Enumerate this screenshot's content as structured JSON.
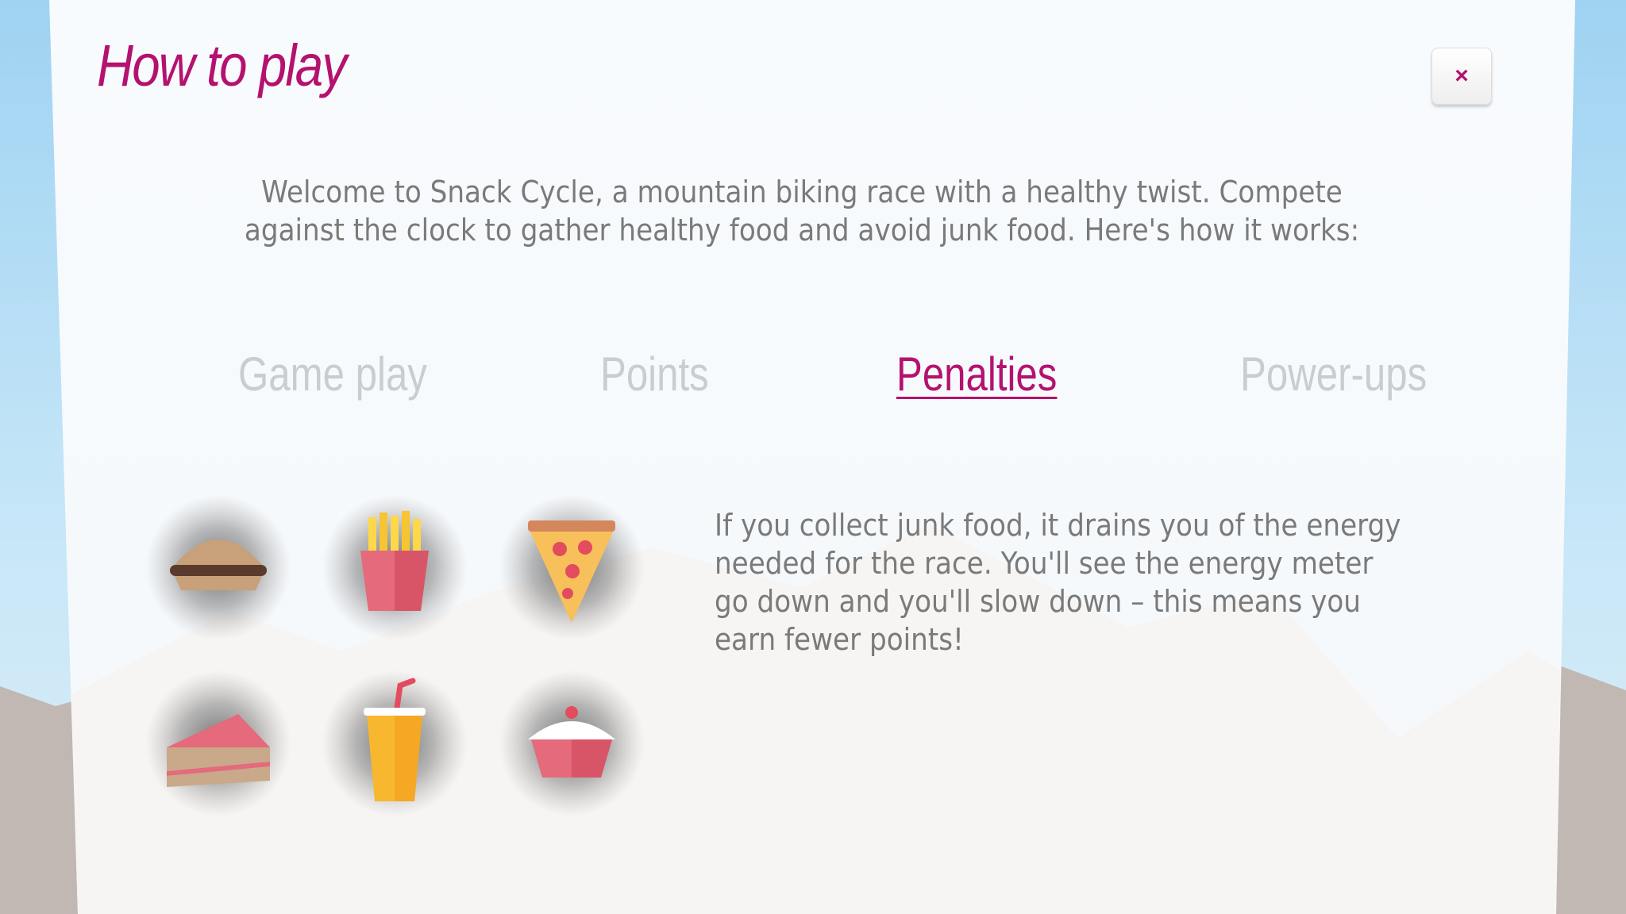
{
  "dialog": {
    "title": "How to play",
    "close_label": "×",
    "intro": "Welcome to Snack Cycle, a mountain biking race with a healthy twist. Compete against the clock to gather healthy food and avoid junk food. Here's how it works:"
  },
  "tabs": [
    {
      "label": "Game play",
      "active": false
    },
    {
      "label": "Points",
      "active": false
    },
    {
      "label": "Penalties",
      "active": true
    },
    {
      "label": "Power-ups",
      "active": false
    }
  ],
  "penalties": {
    "description": "If you collect junk food, it drains you of the energy needed for the race. You'll see the energy meter go down and you'll slow down – this means you earn fewer points!",
    "items": [
      "burger-icon",
      "fries-icon",
      "pizza-slice-icon",
      "cake-slice-icon",
      "soda-cup-icon",
      "cupcake-icon"
    ]
  },
  "colors": {
    "accent": "#b5116f",
    "tab_inactive": "#c9ccd0",
    "text": "#7a7a7a",
    "sky": "#9fd3f2",
    "mountain": "#c1b7b3",
    "panel": "#f6fafc"
  }
}
